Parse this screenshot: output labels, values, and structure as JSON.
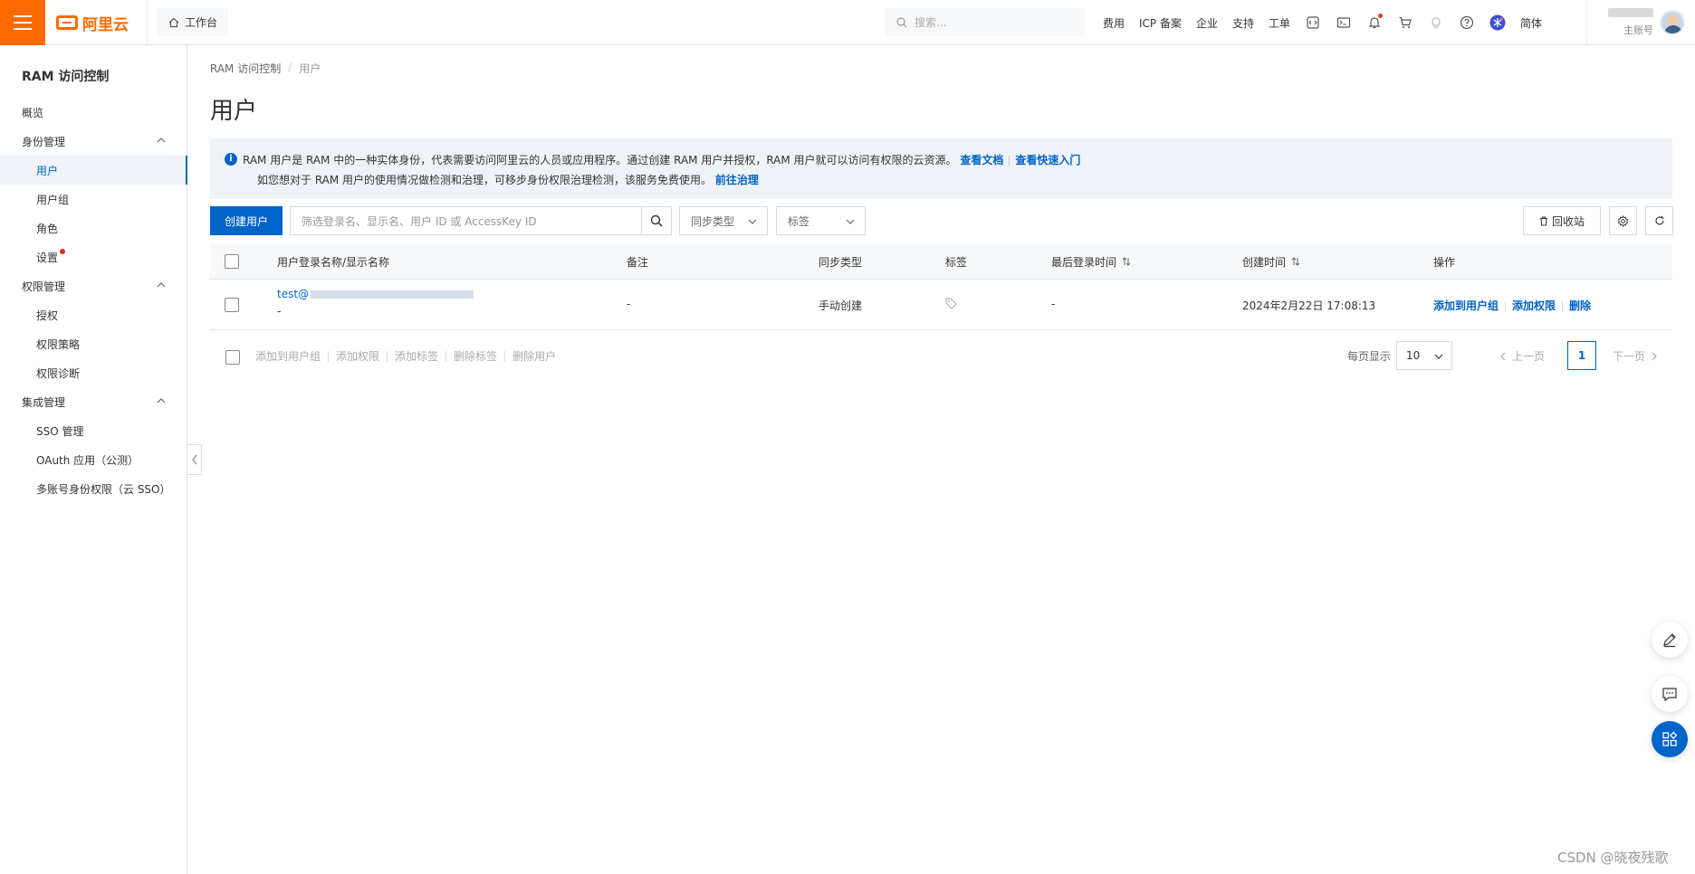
{
  "topbar": {
    "logo_text": "阿里云",
    "workbench_label": "工作台",
    "search_placeholder": "搜索...",
    "links": [
      "费用",
      "ICP 备案",
      "企业",
      "支持",
      "工单"
    ],
    "lang": "简体",
    "account_sub": "主账号"
  },
  "sidebar": {
    "title": "RAM 访问控制",
    "items": [
      {
        "label": "概览"
      },
      {
        "label": "身份管理"
      },
      {
        "label": "用户"
      },
      {
        "label": "用户组"
      },
      {
        "label": "角色"
      },
      {
        "label": "设置"
      },
      {
        "label": "权限管理"
      },
      {
        "label": "授权"
      },
      {
        "label": "权限策略"
      },
      {
        "label": "权限诊断"
      },
      {
        "label": "集成管理"
      },
      {
        "label": "SSO 管理"
      },
      {
        "label": "OAuth 应用（公测）"
      },
      {
        "label": "多账号身份权限（云 SSO）"
      }
    ]
  },
  "breadcrumb": {
    "root": "RAM 访问控制",
    "sep": "/",
    "current": "用户"
  },
  "page_title": "用户",
  "notice": {
    "line1": "RAM 用户是 RAM 中的一种实体身份，代表需要访问阿里云的人员或应用程序。通过创建 RAM 用户并授权，RAM 用户就可以访问有权限的云资源。",
    "link_docs": "查看文档",
    "link_quickstart": "查看快速入门",
    "line2": "如您想对于 RAM 用户的使用情况做检测和治理，可移步身份权限治理检测，该服务免费使用。",
    "link_govern": "前往治理"
  },
  "toolbar": {
    "create_label": "创建用户",
    "filter_placeholder": "筛选登录名、显示名、用户 ID 或 AccessKey ID",
    "sync_type": "同步类型",
    "tag": "标签",
    "recycle": "回收站"
  },
  "table": {
    "headers": [
      "用户登录名称/显示名称",
      "备注",
      "同步类型",
      "标签",
      "最后登录时间",
      "创建时间",
      "操作"
    ],
    "rows": [
      {
        "login": "test@",
        "display": "-",
        "remark": "-",
        "sync": "手动创建",
        "last_login": "-",
        "created": "2024年2月22日 17:08:13",
        "ops": [
          "添加到用户组",
          "添加权限",
          "删除"
        ]
      }
    ]
  },
  "batch_actions": [
    "添加到用户组",
    "添加权限",
    "添加标签",
    "删除标签",
    "删除用户"
  ],
  "pager": {
    "size_label": "每页显示",
    "size": "10",
    "prev": "上一页",
    "page": "1",
    "next": "下一页"
  },
  "watermark": "CSDN @晓夜残歌",
  "colors": {
    "brand": "#ff6a00",
    "primary": "#0064c8"
  }
}
